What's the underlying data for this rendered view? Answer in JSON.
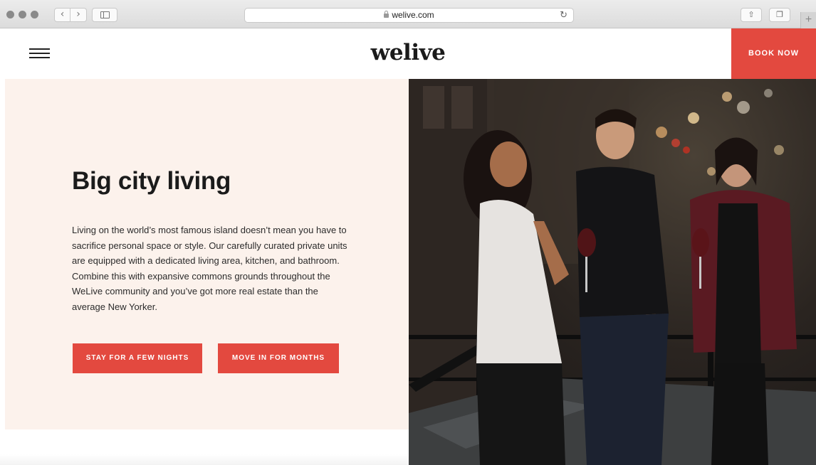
{
  "browser": {
    "url": "welive.com",
    "icons": [
      "back-icon",
      "forward-icon",
      "sidebar-icon",
      "lock-icon",
      "reload-icon",
      "share-icon",
      "tabs-icon",
      "new-tab-icon"
    ]
  },
  "header": {
    "logo": "welive",
    "book_now": "BOOK NOW"
  },
  "hero": {
    "title": "Big city living",
    "body": "Living on the world’s most famous island doesn’t mean you have to sacrifice personal space or style. Our carefully curated private units are equipped with a dedicated living area, kitchen, and bathroom. Combine this with expansive commons grounds throughout the WeLive community and you’ve got more real estate than the average New Yorker.",
    "btn_stay": "STAY FOR A FEW NIGHTS",
    "btn_move": "MOVE IN FOR MONTHS"
  },
  "colors": {
    "accent": "#e3493f",
    "hero_bg": "#fcf2ec"
  }
}
